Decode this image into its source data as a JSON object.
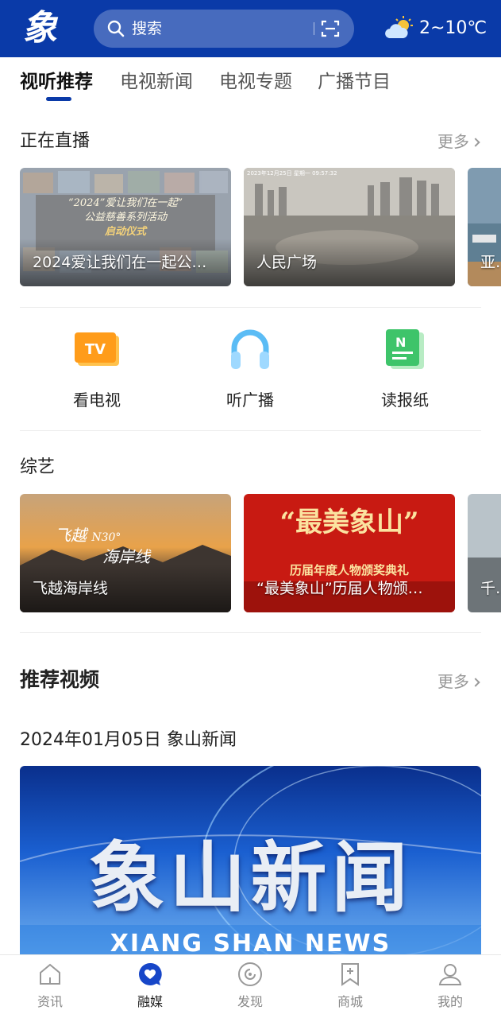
{
  "header": {
    "logo_text": "象",
    "search_placeholder": "搜索",
    "weather": "2~10℃"
  },
  "tabs": [
    {
      "label": "视听推荐",
      "active": true
    },
    {
      "label": "电视新闻",
      "active": false
    },
    {
      "label": "电视专题",
      "active": false
    },
    {
      "label": "广播节目",
      "active": false
    }
  ],
  "live": {
    "title": "正在直播",
    "more": "更多",
    "cards": [
      {
        "caption": "2024爱让我们在一起公…",
        "overlay_line1": "“2024”爱让我们在一起”",
        "overlay_line2": "公益慈善系列活动",
        "overlay_line3": "启动仪式"
      },
      {
        "caption": "人民广场"
      },
      {
        "caption": "亚帆"
      }
    ]
  },
  "quick_links": [
    {
      "label": "看电视",
      "icon": "tv-icon",
      "icon_text": "TV"
    },
    {
      "label": "听广播",
      "icon": "headphones-icon"
    },
    {
      "label": "读报纸",
      "icon": "newspaper-icon",
      "icon_text": "N"
    }
  ],
  "variety": {
    "title": "综艺",
    "cards": [
      {
        "caption": "飞越海岸线",
        "overlay_line1": "飞越",
        "overlay_line2": "N30°",
        "overlay_line3": "海岸线"
      },
      {
        "caption": "“最美象山”历届人物颁…",
        "overlay_title": "“最美象山”",
        "overlay_sub": "历届年度人物颁奖典礼"
      },
      {
        "caption": "千年"
      }
    ]
  },
  "recommend": {
    "title": "推荐视频",
    "more": "更多",
    "date_line": "2024年01月05日 象山新闻",
    "banner_title": "象山新闻",
    "banner_sub": "XIANG SHAN NEWS"
  },
  "bottom_nav": [
    {
      "label": "资讯",
      "icon": "home-icon",
      "active": false
    },
    {
      "label": "融媒",
      "icon": "heart-chat-icon",
      "active": true
    },
    {
      "label": "发现",
      "icon": "discover-icon",
      "active": false
    },
    {
      "label": "商城",
      "icon": "bookmark-plus-icon",
      "active": false
    },
    {
      "label": "我的",
      "icon": "user-icon",
      "active": false
    }
  ],
  "colors": {
    "brand": "#0a3aa8",
    "active_nav": "#1746c8"
  }
}
